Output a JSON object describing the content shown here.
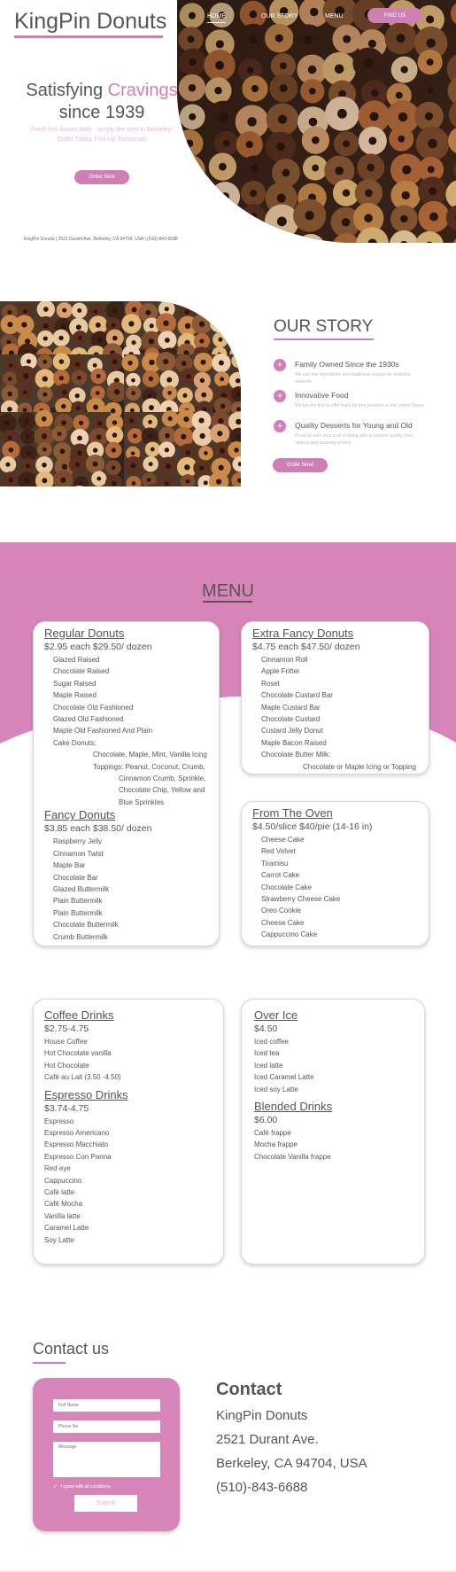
{
  "brand": "KingPin Donuts",
  "colors": {
    "accent": "#d07fb4",
    "menu_band": "#d785b8",
    "accent_light": "#ecb7d6"
  },
  "nav": {
    "home": "HOME",
    "story": "OUR STORY",
    "menu": "MENU",
    "find_us": "FIND US"
  },
  "hero": {
    "title_part1": "Satisfying",
    "title_accent": "Cravings",
    "title_part2": "since 1939",
    "subtitle_line1": "Fresh hot donuts daily - simply the best in Berkeley!",
    "subtitle_line2": "Order Today, Pick Up Tomorrow!",
    "order_button": "Order Now",
    "address": "KingPin Donuts | 2521 Durant Ave, Berkeley, CA 94704, USA | (510)-843-6688"
  },
  "story": {
    "title": "OUR STORY",
    "items": [
      {
        "title": "Family Owned Since the 1930s",
        "desc": "We use fine ingredients and traditional recipes for delicious desserts"
      },
      {
        "title": "Innovative Food",
        "desc": "We are the first to offer trans-fat free products in the United States"
      },
      {
        "title": "Quality Desserts for Young and Old",
        "desc": "Proud to earn your trust in being able to present quality food options and amazing service"
      }
    ],
    "button": "Order Now!"
  },
  "menu": {
    "title": "MENU",
    "regular": {
      "title": "Regular Donuts",
      "price": "$2.95 each    $29.50/ dozen",
      "items": [
        "Glazed Raised",
        "Chocolate Raised",
        "Sugar Raised",
        "Maple Raised",
        "Chocolate Old Fashioned",
        "Glazed Old Fashioned",
        "Maple Old Fashioned And Plain",
        "Cake Donuts:"
      ],
      "cake_flavors": "Chocolate, Maple, Mint, Vanilla Icing",
      "toppings": [
        "Toppings: Peanut, Coconut, Crumb,",
        "Cinnamon Crumb, Sprinkle,",
        "Chocolate Chip, Yellow and",
        "Blue Sprinkles"
      ]
    },
    "fancy": {
      "title": "Fancy Donuts",
      "price": "$3.85 each    $38.50/ dozen",
      "items": [
        "Raspberry Jelly",
        "Cinnamon Twist",
        "Maple Bar",
        "Chocolate  Bar",
        "Glazed Buttermilk",
        "Plain Buttermilk",
        "Plain Buttermilk",
        "Chocolate Buttermilk",
        "Crumb Buttermilk"
      ]
    },
    "extra_fancy": {
      "title": "Extra Fancy Donuts",
      "price": "$4.75 each    $47.50/ dozen",
      "items": [
        "Cinnamon Roll",
        "Apple Fritter",
        "Roset",
        "Chocolate Custard Bar",
        "Maple Custard Bar",
        "Chocolate Custard",
        "Custard Jelly Donut",
        "Maple Bacon Raised",
        "Chocolate Butter Milk:"
      ],
      "butter_milk_note": "Chocolate or Maple Icing or Topping"
    },
    "oven": {
      "title": "From The Oven",
      "price": "$4.50/slice   $40/pie (14-16 in)",
      "items": [
        "Cheese Cake",
        "Red Velvet",
        "Tiramisu",
        "Carrot Cake",
        "Chocolate Cake",
        "Strawberry Cheese Cake",
        "Oreo Cookie",
        "Cheese Cake",
        "Cappuccino Cake"
      ]
    },
    "coffee": {
      "title": "Coffee Drinks",
      "price": "$2.75-4.75",
      "items": [
        "House Coffee",
        "Hot Chocolate vanilla",
        "Hot Chocolate",
        "Café au Lait     (3.50 -4.50)"
      ]
    },
    "espresso": {
      "title": "Espresso Drinks",
      "price": "$3.74-4.75",
      "items": [
        "Espresso",
        "Espresso Americano",
        "Espresso Macchiato",
        "Espresso Con Panna",
        "Red eye",
        "Cappuccino",
        "Café latte",
        "Café Mocha",
        "Vanilla latte",
        "Caramel Latte",
        "Soy Latte"
      ]
    },
    "over_ice": {
      "title": "Over Ice",
      "price": "$4.50",
      "items": [
        "Iced coffee",
        "Iced tea",
        "Iced  latte",
        "Iced Caramel Latte",
        "Iced soy Latte"
      ]
    },
    "blended": {
      "title": "Blended Drinks",
      "price": "$6.00",
      "items": [
        "Café frappe",
        "Mocha frappe",
        "Chocolate Vanilla frappe"
      ]
    }
  },
  "contact": {
    "heading": "Contact us",
    "form": {
      "name_placeholder": "Full Name",
      "phone_placeholder": "Phone No.",
      "message_placeholder": "Message",
      "agree": "I agree with all conditions",
      "submit": "Submit"
    },
    "side_title": "Contact",
    "name": "KingPin Donuts",
    "street": "2521 Durant Ave.",
    "city": "Berkeley, CA 94704, USA",
    "phone": "(510)-843-6688"
  }
}
